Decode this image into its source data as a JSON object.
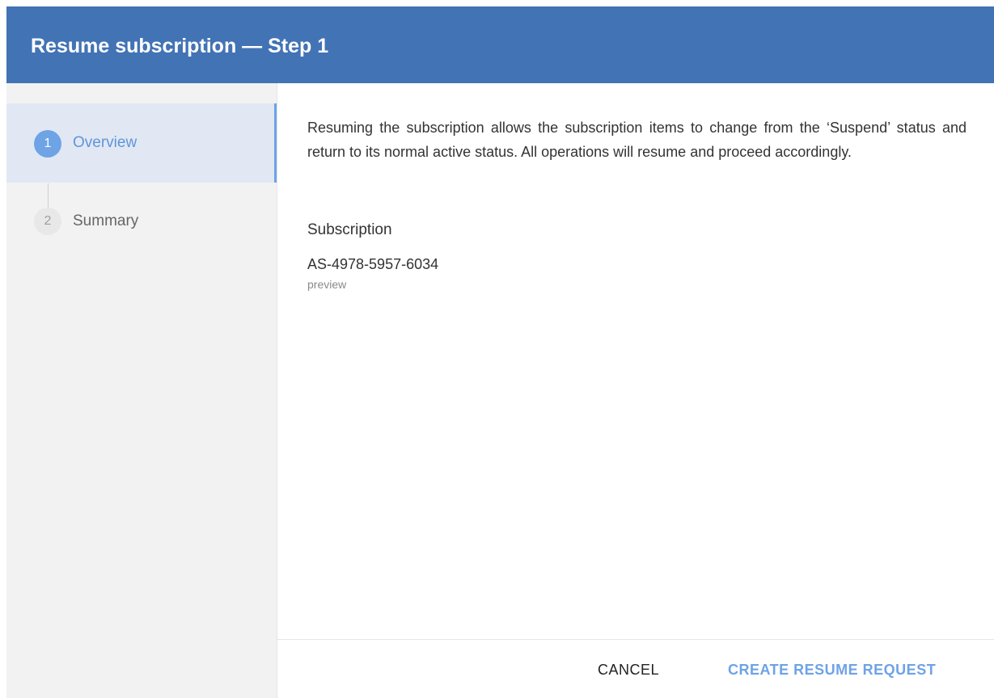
{
  "header": {
    "title": "Resume subscription — Step 1"
  },
  "steps": [
    {
      "number": "1",
      "label": "Overview",
      "state": "active"
    },
    {
      "number": "2",
      "label": "Summary",
      "state": "inactive"
    }
  ],
  "content": {
    "description": "Resuming the subscription allows the subscription items to change from the ‘Suspend’ status and return to its normal active status. All operations will resume and proceed accordingly.",
    "subscription_label": "Subscription",
    "subscription_id": "AS-4978-5957-6034",
    "subscription_subtext": "preview"
  },
  "footer": {
    "cancel_label": "CANCEL",
    "create_label": "CREATE RESUME REQUEST"
  },
  "colors": {
    "header_bg": "#4273b5",
    "accent": "#6ea3e6",
    "sidebar_bg": "#f2f2f2",
    "active_step_bg": "#e1e8f3"
  }
}
